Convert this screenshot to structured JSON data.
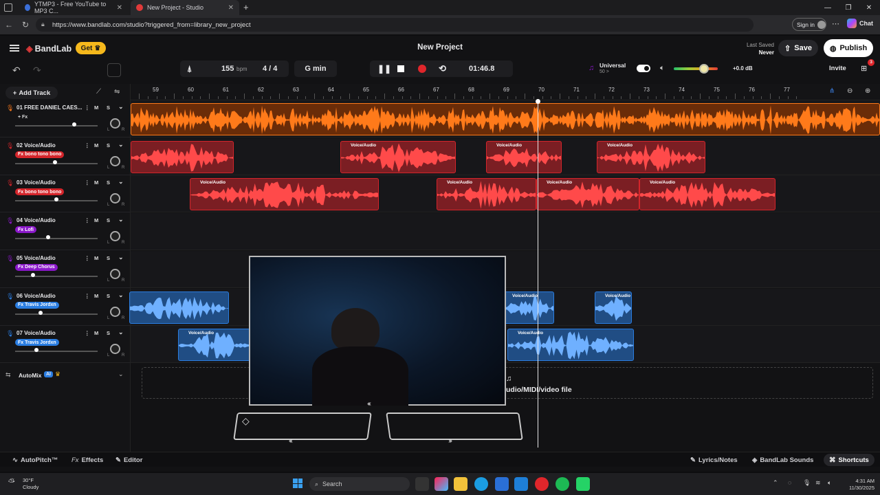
{
  "browser": {
    "tabs": [
      {
        "title": "YTMP3 - Free YouTube to MP3 C..."
      },
      {
        "title": "New Project - Studio"
      }
    ],
    "url": "https://www.bandlab.com/studio?triggered_from=library_new_project",
    "signin_label": "Sign in",
    "chat_label": "Chat"
  },
  "app": {
    "logo": "BandLab",
    "get_label": "Get",
    "project_title": "New Project",
    "last_saved_label": "Last Saved",
    "last_saved_value": "Never",
    "save_label": "Save",
    "publish_label": "Publish",
    "invite_label": "Invite",
    "invite_badge": "3"
  },
  "toolbar": {
    "bpm_value": "155",
    "bpm_unit": "bpm",
    "time_sig": "4 / 4",
    "key": "G min",
    "time": "01:46.8",
    "universal_label": "Universal",
    "universal_sub": "50 >",
    "volume_db": "+0.0 dB",
    "add_track": "Add Track"
  },
  "ruler": {
    "bars": [
      "59",
      "60",
      "61",
      "62",
      "63",
      "64",
      "65",
      "66",
      "67",
      "68",
      "69",
      "70",
      "71",
      "72",
      "73",
      "74",
      "75",
      "76",
      "77"
    ]
  },
  "tracks": [
    {
      "name": "01  FREE DANIEL CAES...",
      "fx": "+ Fx",
      "fx_color": "",
      "color": "#ff7a1a",
      "slider": 0.72
    },
    {
      "name": "02  Voice/Audio",
      "fx": "Fx bono tono bono",
      "fx_color": "#d4252b",
      "color": "#d4252b",
      "slider": 0.48
    },
    {
      "name": "03  Voice/Audio",
      "fx": "Fx bono tono bono",
      "fx_color": "#d4252b",
      "color": "#d4252b",
      "slider": 0.5
    },
    {
      "name": "04  Voice/Audio",
      "fx": "Fx Lofi",
      "fx_color": "#8a18c9",
      "color": "#8a18c9",
      "slider": 0.4
    },
    {
      "name": "05  Voice/Audio",
      "fx": "Fx Deep Chorus",
      "fx_color": "#8a18c9",
      "color": "#8a18c9",
      "slider": 0.22
    },
    {
      "name": "06  Voice/Audio",
      "fx": "Fx Travis Jordxn",
      "fx_color": "#2a7de1",
      "color": "#2a7de1",
      "slider": 0.31
    },
    {
      "name": "07  Voice/Audio",
      "fx": "Fx Travis Jordxn",
      "fx_color": "#2a7de1",
      "color": "#2a7de1",
      "slider": 0.26
    }
  ],
  "track_buttons": {
    "mute": "M",
    "solo": "S",
    "dial_l": "L",
    "dial_r": "R"
  },
  "clip_label": "Voice/Audio",
  "automix": {
    "label": "AutoMix",
    "badge": "AI"
  },
  "dropzone_text": "udio/MIDI/video file",
  "bottom": {
    "autopitch": "AutoPitch™",
    "effects": "Effects",
    "editor": "Editor",
    "lyrics": "Lyrics/Notes",
    "sounds": "BandLab Sounds",
    "shortcuts": "Shortcuts"
  },
  "taskbar": {
    "weather_temp": "30°F",
    "weather_desc": "Cloudy",
    "search": "Search",
    "time": "4:31 AM",
    "date": "11/30/2025"
  },
  "colors": {
    "orange": "#ff7a1a",
    "red": "#d4252b",
    "purple": "#8a18c9",
    "blue": "#2a7de1",
    "get_yellow": "#f5b81c"
  }
}
